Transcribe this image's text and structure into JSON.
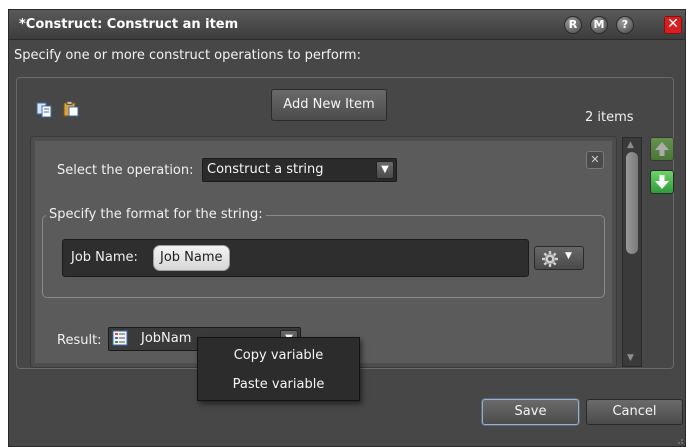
{
  "window": {
    "title": "*Construct: Construct an item",
    "title_buttons": [
      "R",
      "M",
      "?"
    ],
    "close_glyph": "✕"
  },
  "instruction": "Specify one or more construct operations to perform:",
  "toolbar": {
    "copy_icon": "copy-icon",
    "paste_icon": "paste-icon",
    "add_button": "Add New Item",
    "items_count": "2 items"
  },
  "item": {
    "operation_label": "Select the operation:",
    "operation_value": "Construct a string",
    "close_glyph": "✕",
    "format_legend": "Specify the format for the string:",
    "format_prefix": "Job Name:",
    "format_token": "Job Name",
    "result_label": "Result:",
    "result_value": "JobNam"
  },
  "context_menu": {
    "items": [
      "Copy variable",
      "Paste variable"
    ]
  },
  "footer": {
    "save": "Save",
    "cancel": "Cancel"
  },
  "colors": {
    "window_bg": "#474747",
    "close_red": "#d81f1f",
    "move_up_green": "#6dbb44",
    "move_down_green": "#3fb54a"
  }
}
